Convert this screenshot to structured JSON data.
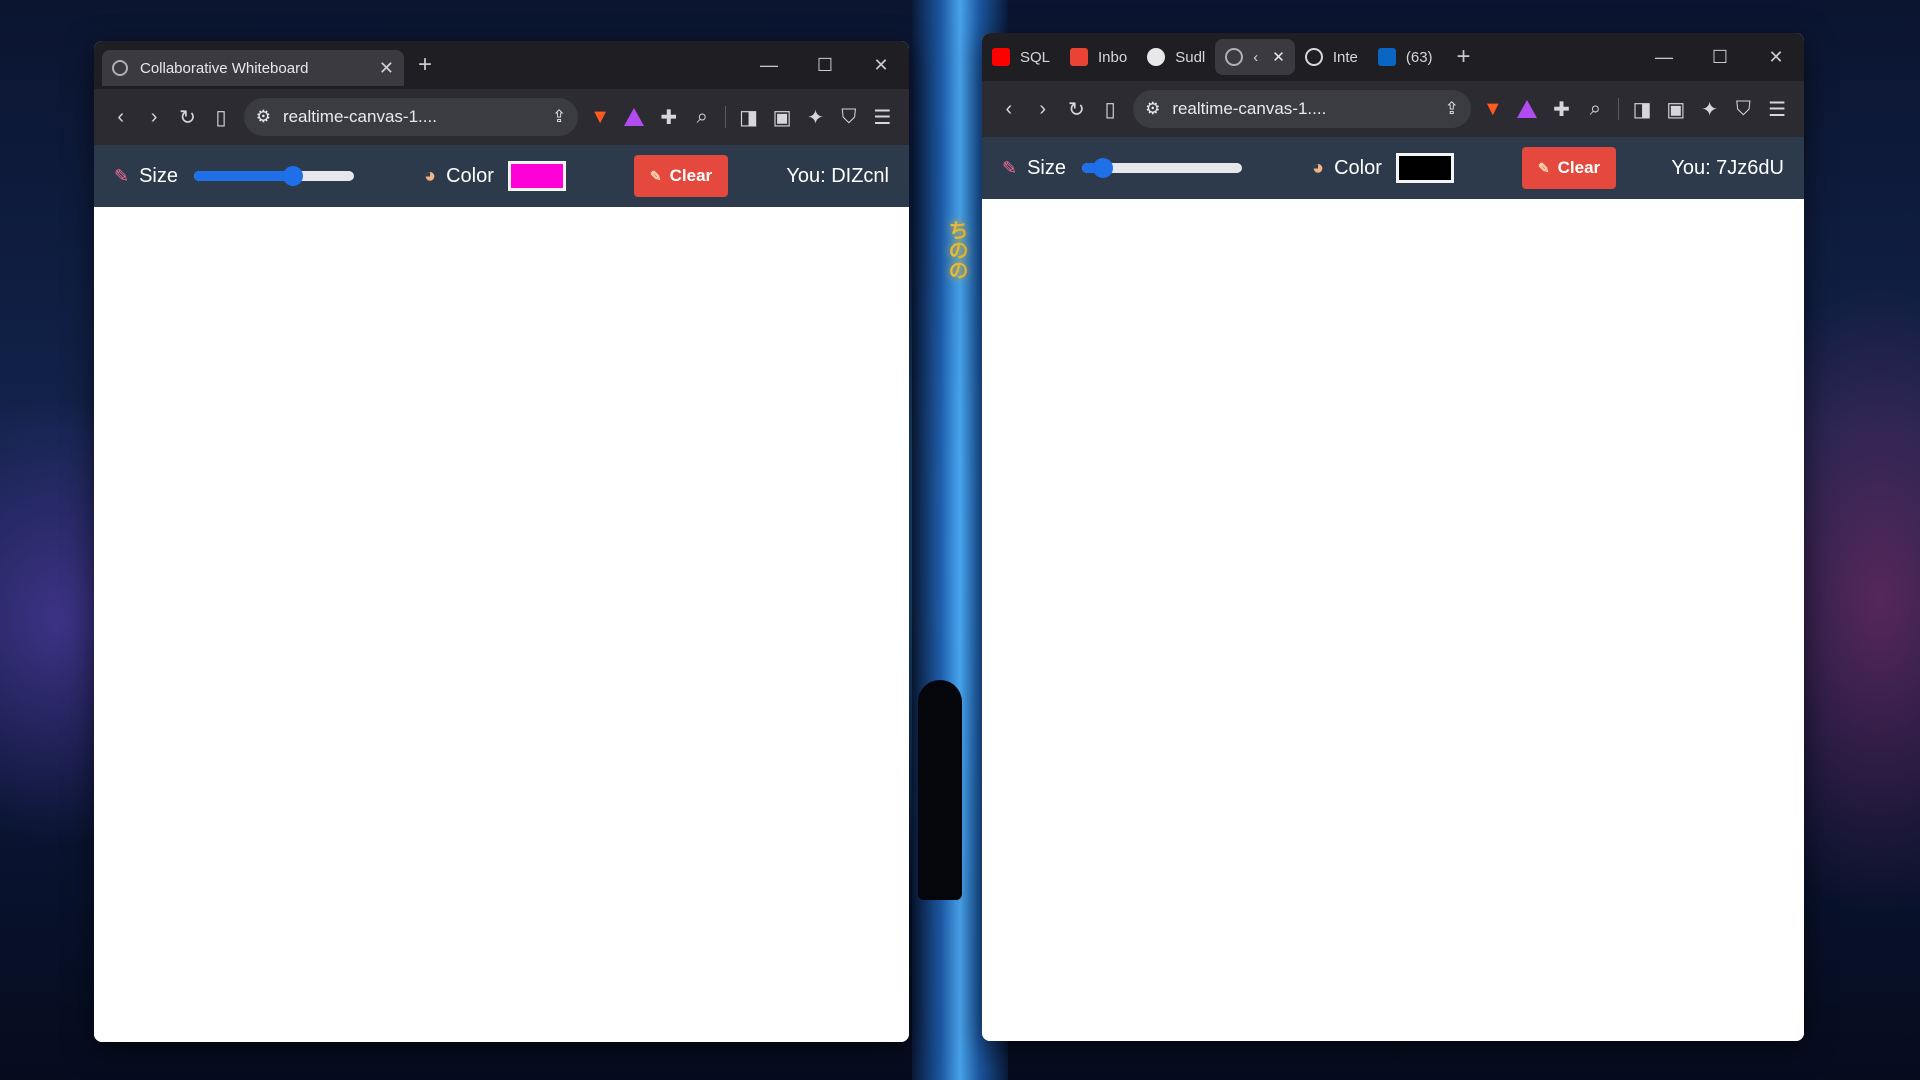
{
  "left_window": {
    "tab_title": "Collaborative Whiteboard",
    "tab_close": "✕",
    "new_tab": "+",
    "url": "realtime-canvas-1....",
    "app": {
      "size_label": "Size",
      "size_value": 0.62,
      "color_label": "Color",
      "color_value": "#ff00d6",
      "clear_label": "Clear",
      "you_label": "You: DIZcnl"
    }
  },
  "right_window": {
    "tabs": [
      {
        "label": "SQL",
        "icon": "youtube-icon"
      },
      {
        "label": "Inbo",
        "icon": "gmail-icon"
      },
      {
        "label": "Sudl",
        "icon": "github-icon"
      },
      {
        "label": "‹",
        "icon": "globe-icon",
        "active": true
      },
      {
        "label": "Inte",
        "icon": "openai-icon"
      },
      {
        "label": "(63)",
        "icon": "linkedin-icon"
      }
    ],
    "tab_close": "✕",
    "new_tab": "+",
    "url": "realtime-canvas-1....",
    "app": {
      "size_label": "Size",
      "size_value": 0.13,
      "color_label": "Color",
      "color_value": "#000000",
      "clear_label": "Clear",
      "you_label": "You: 7Jz6dU"
    }
  },
  "colors": {
    "accent_blue": "#1e6fe8",
    "clear_red": "#e5493e",
    "appbar": "#2d3a4b"
  }
}
